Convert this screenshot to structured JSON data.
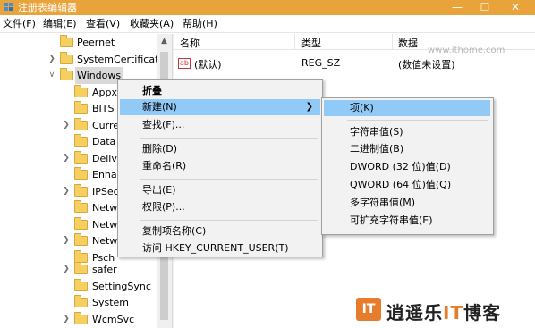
{
  "window": {
    "title": "注册表编辑器",
    "minimize": "—",
    "maximize": "☐",
    "close": "✕",
    "accent": "#e8a33b"
  },
  "menubar": {
    "items": [
      "文件(F)",
      "编辑(E)",
      "查看(V)",
      "收藏夹(A)",
      "帮助(H)"
    ]
  },
  "tree": {
    "items": [
      {
        "label": "Peernet",
        "expandable": false
      },
      {
        "label": "SystemCertificate",
        "expandable": true
      },
      {
        "label": "Windows",
        "expandable": true,
        "expanded": true,
        "selected": true
      },
      {
        "label": "Appx",
        "expandable": false
      },
      {
        "label": "BITS",
        "expandable": false
      },
      {
        "label": "Curre",
        "expandable": true
      },
      {
        "label": "Data",
        "expandable": false
      },
      {
        "label": "Deliv",
        "expandable": true
      },
      {
        "label": "Enha",
        "expandable": false
      },
      {
        "label": "IPSec",
        "expandable": true
      },
      {
        "label": "Netw",
        "expandable": false
      },
      {
        "label": "Netw",
        "expandable": false
      },
      {
        "label": "Netw",
        "expandable": true
      },
      {
        "label": "Psch",
        "expandable": false
      },
      {
        "label": "safer",
        "expandable": true
      },
      {
        "label": "SettingSync",
        "expandable": false
      },
      {
        "label": "System",
        "expandable": false
      },
      {
        "label": "WcmSvc",
        "expandable": true
      }
    ]
  },
  "list": {
    "columns": {
      "name": "名称",
      "type": "类型",
      "data": "数据"
    },
    "rows": [
      {
        "icon": "string-value-icon",
        "icon_text": "ab",
        "name": "(默认)",
        "type": "REG_SZ",
        "data": "(数值未设置)"
      }
    ],
    "watermark": "www.ithome.com"
  },
  "context_menu": {
    "collapse": "折叠",
    "new": "新建(N)",
    "find": "查找(F)...",
    "delete": "删除(D)",
    "rename": "重命名(R)",
    "export": "导出(E)",
    "permissions": "权限(P)...",
    "copy_key_name": "复制项名称(C)",
    "goto": "访问 HKEY_CURRENT_USER(T)"
  },
  "submenu": {
    "key": "项(K)",
    "string": "字符串值(S)",
    "binary": "二进制值(B)",
    "dword": "DWORD (32 位)值(D)",
    "qword": "QWORD (64 位)值(Q)",
    "multi_string": "多字符串值(M)",
    "expandable_string": "可扩充字符串值(E)"
  },
  "logo": {
    "mark": "IT",
    "name_prefix": "逍遥乐",
    "name_it": "IT",
    "name_suffix": "博客",
    "brand_color": "#e57d2d"
  },
  "colors": {
    "highlight": "#91c9f7",
    "menu_bg": "#f2f2f2"
  }
}
